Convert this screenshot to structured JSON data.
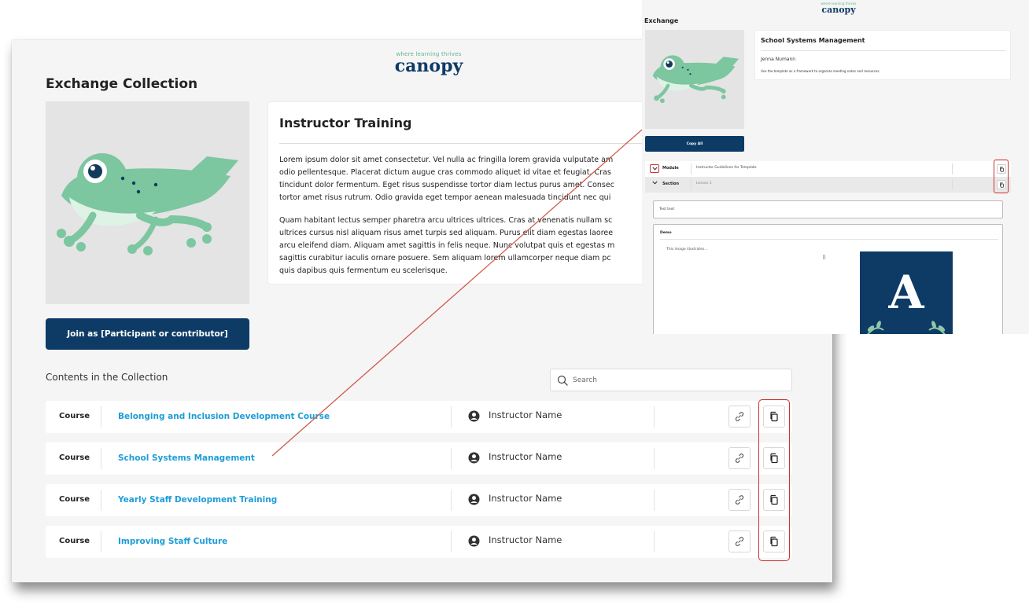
{
  "brand": {
    "tagline": "where learning thrives",
    "logo": "canopy"
  },
  "page": {
    "title": "Exchange Collection",
    "join_label": "Join as [Participant or contributor]"
  },
  "card": {
    "title": "Instructor Training",
    "paragraph1": [
      "Lorem ipsum dolor sit amet consectetur. Vel nulla ac fringilla lorem gravida vulputate am",
      "odio pellentesque. Placerat dictum augue cras commodo aliquet id vitae et feugiat. Cras",
      "tincidunt dolor fermentum. Eget risus suspendisse tortor diam lectus purus amet. Consec",
      "tortor amet risus rutrum. Odio gravida eget tempor aenean malesuada tincidunt nec qui"
    ],
    "paragraph2": [
      "Quam habitant lectus semper pharetra arcu ultrices ultrices. Cras at venenatis nullam sc",
      "ultrices cursus nisl aliquam risus amet turpis sed aliquam. Purus elit diam egestas laoree",
      "arcu eleifend diam. Aliquam amet sagittis in felis neque. Nunc volutpat quis et egestas m",
      "sagittis curabitur iaculis ornare posuere. Sem aliquam lorem ullamcorper neque diam pc",
      "quis dapibus quis fermentum eu scelerisque."
    ]
  },
  "contents": {
    "title": "Contents in the Collection",
    "search_placeholder": "Search",
    "rows": [
      {
        "type": "Course",
        "title": "Belonging and Inclusion Development Course",
        "instructor": "Instructor Name"
      },
      {
        "type": "Course",
        "title": "School Systems Management",
        "instructor": "Instructor Name"
      },
      {
        "type": "Course",
        "title": "Yearly Staff Development Training",
        "instructor": "Instructor Name"
      },
      {
        "type": "Course",
        "title": "Improving Staff Culture",
        "instructor": "Instructor Name"
      }
    ]
  },
  "inset": {
    "title": "Exchange",
    "card_title": "School Systems Management",
    "author": "Jenna Numann",
    "description": "Use the template as a framework to organize meeting notes and resources.",
    "copy_all_label": "Copy All",
    "module_label": "Module",
    "module_value": "Instructor Guidelines for Template",
    "section_label": "Section",
    "section_value": "Lesson 1",
    "text_block": "Test text",
    "demo_title": "Demo",
    "demo_caption": "This image illustrates...",
    "drag_glyph": "⠿",
    "poster_letter": "A"
  },
  "colors": {
    "brand_navy": "#0d3b66",
    "link_blue": "#1e9dd8",
    "frog_green": "#7cc6a0",
    "highlight_red": "#d0302f"
  },
  "icons": {
    "search": "search-icon",
    "person": "user-circle-icon",
    "link": "link-icon",
    "copy": "copy-icon",
    "chevron": "chevron-down-icon"
  }
}
